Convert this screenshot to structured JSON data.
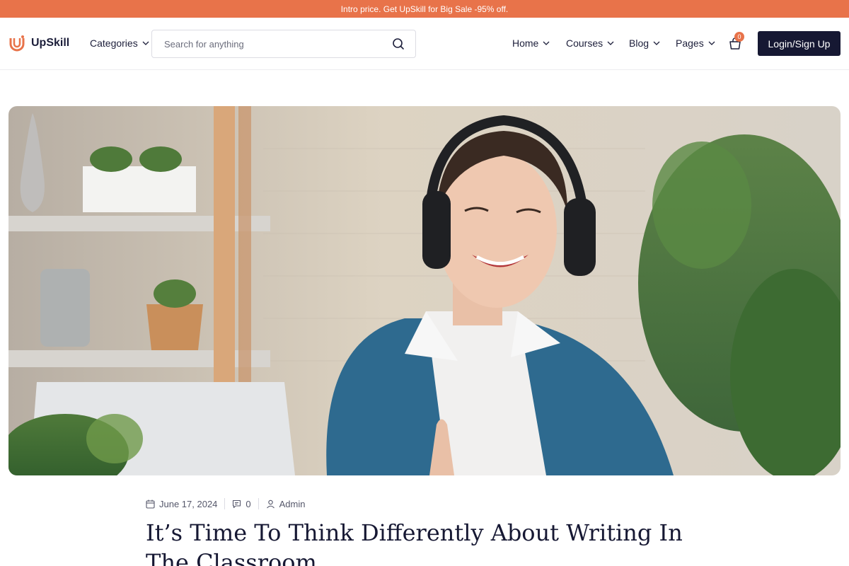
{
  "promo": {
    "text": "Intro price. Get UpSkill for Big Sale -95% off."
  },
  "brand": {
    "name": "UpSkill",
    "accent": "#e8734a",
    "dark": "#161833"
  },
  "header": {
    "categories_label": "Categories",
    "search_placeholder": "Search for anything",
    "nav": {
      "home": "Home",
      "courses": "Courses",
      "blog": "Blog",
      "pages": "Pages"
    },
    "cart_count": "0",
    "login_label": "Login/Sign Up"
  },
  "hero": {
    "image": "photo-woman-with-headphones"
  },
  "post": {
    "date": "June 17, 2024",
    "comments": "0",
    "author": "Admin",
    "title": "It’s Time To Think Differently About Writing In The Classroom"
  }
}
